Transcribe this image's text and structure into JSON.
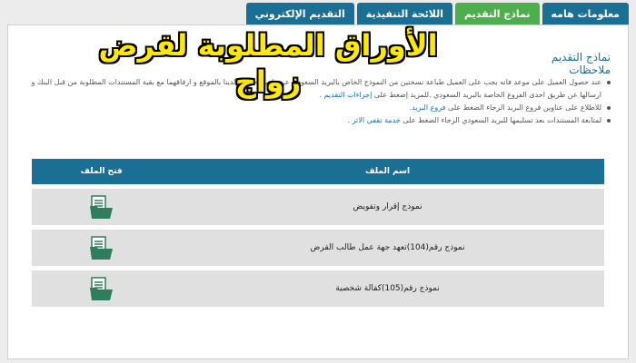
{
  "tabs": [
    {
      "label": "معلومات هامه",
      "active": false
    },
    {
      "label": "نماذج  التقديم",
      "active": true
    },
    {
      "label": "اللائحة التنفيذية",
      "active": false
    },
    {
      "label": "التقديم الإلكتروني",
      "active": false
    }
  ],
  "headline": "الأوراق المطلوبة لقرض زواج",
  "section_title": "نماذج التقديم",
  "notes_title": "ملاحظات",
  "notes": [
    {
      "text": "عند حصول العميل على موعد فانه يجب على العميل طباعة نسختين من النموذج الخاص بالبريد السعودي عن طريق حسابه لدينا بالموقع و ارفاقهما مع بقية المستندات المطلوبة من قبل البنك و ارسالها عن طريق احدى الفروع الخاصة بالبريد السعودي .للمزيد إضغط على",
      "link": "إجراءات التقديم ."
    },
    {
      "text": "للاطلاع على عناوين فروع البريد الرجاء الضغط على",
      "link": "فروع البريد."
    },
    {
      "text": "لمتابعة المستندات بعد تسليمها للبريد السعودي الرجاء الضغط على",
      "link": "خدمة تقفي الاثر ."
    }
  ],
  "table": {
    "col_name": "اسم الملف",
    "col_open": "فتح الملف",
    "rows": [
      {
        "name": "نموذج إقرار وتفويض"
      },
      {
        "name": "نموذج رقم(104)تعهد جهة عمل طالب القرض"
      },
      {
        "name": "نموذج رقم(105)كفالة شخصية"
      }
    ]
  },
  "colors": {
    "tab": "#1a6f95",
    "tab_active": "#4cae4c",
    "header": "#1a6f95",
    "row": "#e0e0e0",
    "headline": "#ffe900",
    "icon": "#2e7d5b"
  },
  "icons": {
    "open_file": "folder-document-icon"
  }
}
